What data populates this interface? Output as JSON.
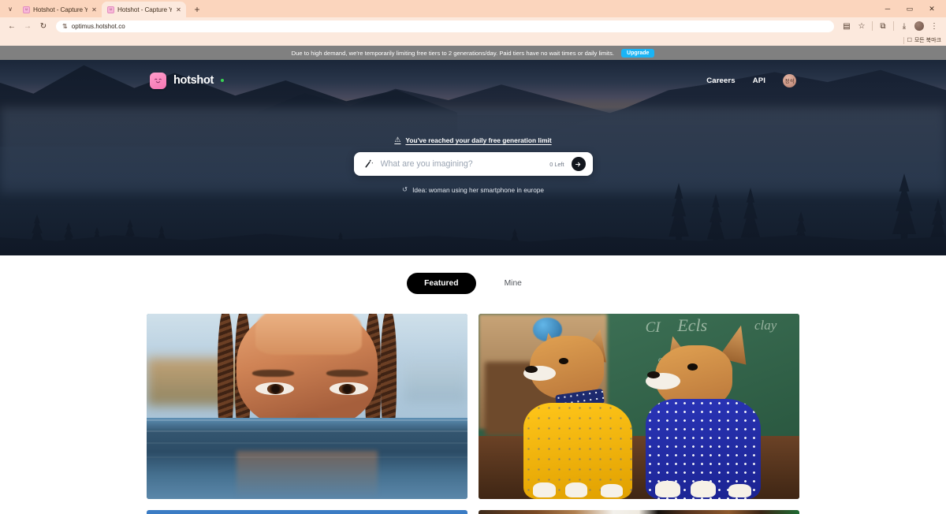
{
  "browser": {
    "tabs": [
      {
        "title": "Hotshot - Capture Your Imagi",
        "favicon": "hotshot-favicon",
        "active": false
      },
      {
        "title": "Hotshot - Capture Your Imagi",
        "favicon": "hotshot-favicon",
        "active": true
      }
    ],
    "new_tab_label": "+",
    "tab_list_chevron": "∨",
    "window_controls": {
      "minimize": "─",
      "maximize": "▭",
      "close": "✕"
    },
    "nav": {
      "back": "←",
      "forward": "→",
      "reload": "↻"
    },
    "omnibox": {
      "site_icon": "⇅",
      "url": "optimus.hotshot.co"
    },
    "toolbar_right": {
      "translate": "▤",
      "bookmark_star": "☆",
      "extensions": "⧉",
      "downloads": "⤓",
      "profile": "profile-avatar",
      "menu": "⋮"
    },
    "bookmarks_bar": {
      "folder_icon": "☐",
      "label": "모든 북마크"
    }
  },
  "notice": {
    "text": "Due to high demand, we're temporarily limiting free tiers to 2 generations/day. Paid tiers have no wait times or daily limits.",
    "upgrade_label": "Upgrade",
    "background_color": "#808080",
    "upgrade_color": "#1ab4f5"
  },
  "hero": {
    "brand": {
      "name": "hotshot",
      "status_dot_color": "#39d353",
      "mark_color": "#f575b2",
      "mark_face": "ᵔ̮ᵔ"
    },
    "nav_links": [
      {
        "label": "Careers"
      },
      {
        "label": "API"
      }
    ],
    "account_avatar_initials": "정석",
    "limit_warning": {
      "icon": "⚠",
      "text": "You've reached your daily free generation limit"
    },
    "prompt": {
      "wand_icon": "🪄",
      "placeholder": "What are you imagining?",
      "value": "",
      "remaining_label": "0 Left",
      "submit_icon": "→"
    },
    "idea": {
      "refresh_icon": "↺",
      "text": "Idea: woman using her smartphone in europe"
    }
  },
  "gallery": {
    "tabs": [
      {
        "label": "Featured",
        "active": true
      },
      {
        "label": "Mine",
        "active": false
      }
    ],
    "items": [
      {
        "name": "portrait-woman-in-water",
        "alt": "Close-up portrait of a woman with braided hair half submerged in water at golden hour"
      },
      {
        "name": "two-corgis-classroom",
        "alt": "Two corgi dogs wearing yellow and blue polka dot outfits in front of a green chalkboard"
      },
      {
        "name": "blue-scene-partial",
        "alt": "Partially visible image with a blue sky"
      },
      {
        "name": "warm-scene-partial",
        "alt": "Partially visible image with warm brown tones"
      }
    ],
    "chalkboard_text": [
      "CI",
      "Ecls",
      "e",
      "t",
      "clay"
    ]
  }
}
